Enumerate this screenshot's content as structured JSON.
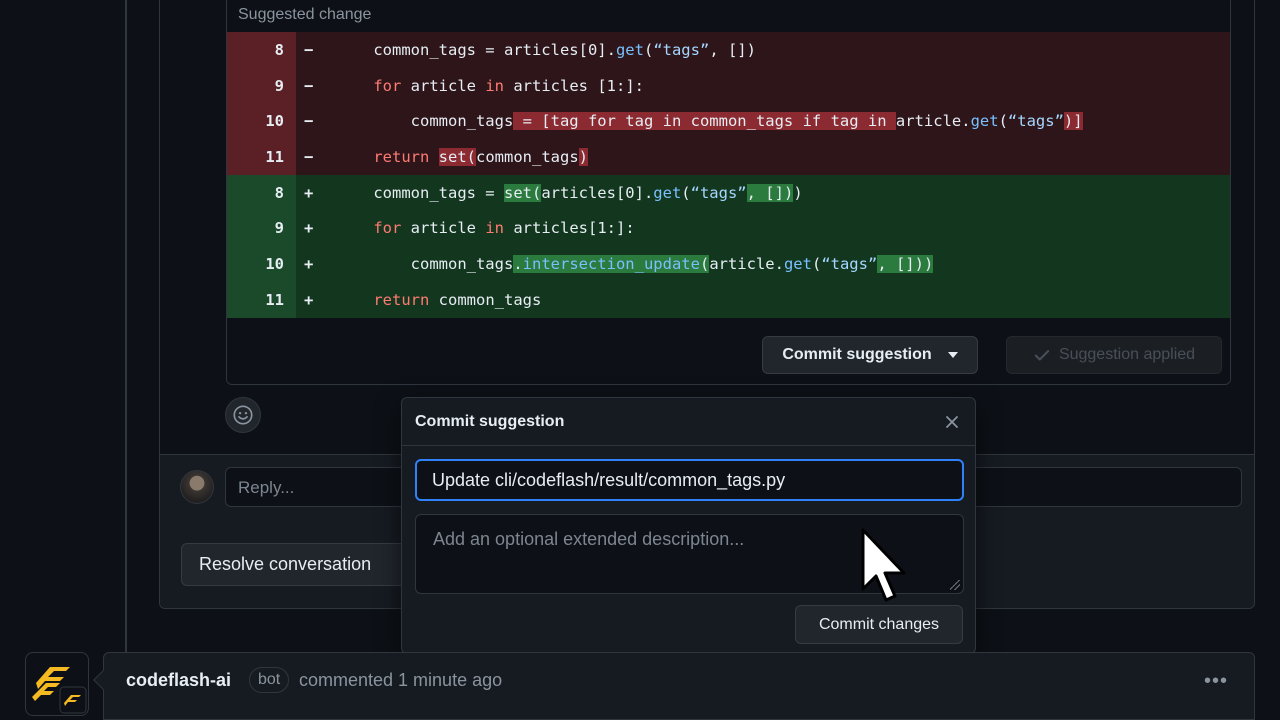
{
  "suggestion": {
    "header": "Suggested change",
    "diff": [
      {
        "type": "del",
        "num": "8",
        "sign": "−",
        "html": "    common_tags = articles[0].<span class=\"fn\">get</span>(<span class=\"str\">“tags”</span>, [])"
      },
      {
        "type": "del",
        "num": "9",
        "sign": "−",
        "html": "    <span class=\"kw\">for</span> article <span class=\"kw\">in</span> articles [1:]:"
      },
      {
        "type": "del",
        "num": "10",
        "sign": "−",
        "html": "        common_tags<span class=\"hl-del\"> = [tag for tag in common_tags if tag in </span>article.<span class=\"fn\">get</span>(<span class=\"str\">“tags”</span><span class=\"hl-del\">)]</span>"
      },
      {
        "type": "del",
        "num": "11",
        "sign": "−",
        "html": "    <span class=\"kw\">return</span> <span class=\"hl-del\">set(</span>common_tags<span class=\"hl-del\">)</span>"
      },
      {
        "type": "add",
        "num": "8",
        "sign": "+",
        "html": "    common_tags = <span class=\"hl-add\">set(</span>articles[0].<span class=\"fn\">get</span>(<span class=\"str\">“tags”</span><span class=\"hl-add\">, [])</span>)"
      },
      {
        "type": "add",
        "num": "9",
        "sign": "+",
        "html": "    <span class=\"kw\">for</span> article <span class=\"kw\">in</span> articles[1:]:"
      },
      {
        "type": "add",
        "num": "10",
        "sign": "+",
        "html": "        common_tags<span class=\"hl-add\">.<span class=\"fn\">intersection_update</span>(</span>article.<span class=\"fn\">get</span>(<span class=\"str\">“tags”</span><span class=\"hl-add\">, []))</span>"
      },
      {
        "type": "add",
        "num": "11",
        "sign": "+",
        "html": "    <span class=\"kw\">return</span> common_tags"
      }
    ],
    "commit_suggestion_label": "Commit suggestion",
    "applied_label": "Suggestion applied"
  },
  "reply": {
    "placeholder": "Reply...",
    "resolve_label": "Resolve conversation"
  },
  "modal": {
    "title": "Commit suggestion",
    "message_value": "Update cli/codeflash/result/common_tags.py",
    "description_placeholder": "Add an optional extended description...",
    "commit_button": "Commit changes"
  },
  "comment": {
    "author": "codeflash-ai",
    "badge": "bot",
    "meta": "commented 1 minute ago"
  },
  "colors": {
    "accent": "#2f81f7",
    "deletion": "#5a2025",
    "addition": "#1b4a2a",
    "logo": "#f5b921"
  },
  "icons": [
    "smiley-icon",
    "caret-down-icon",
    "check-icon",
    "close-icon",
    "cursor-icon",
    "kebab-icon",
    "codeflash-logo-icon"
  ]
}
